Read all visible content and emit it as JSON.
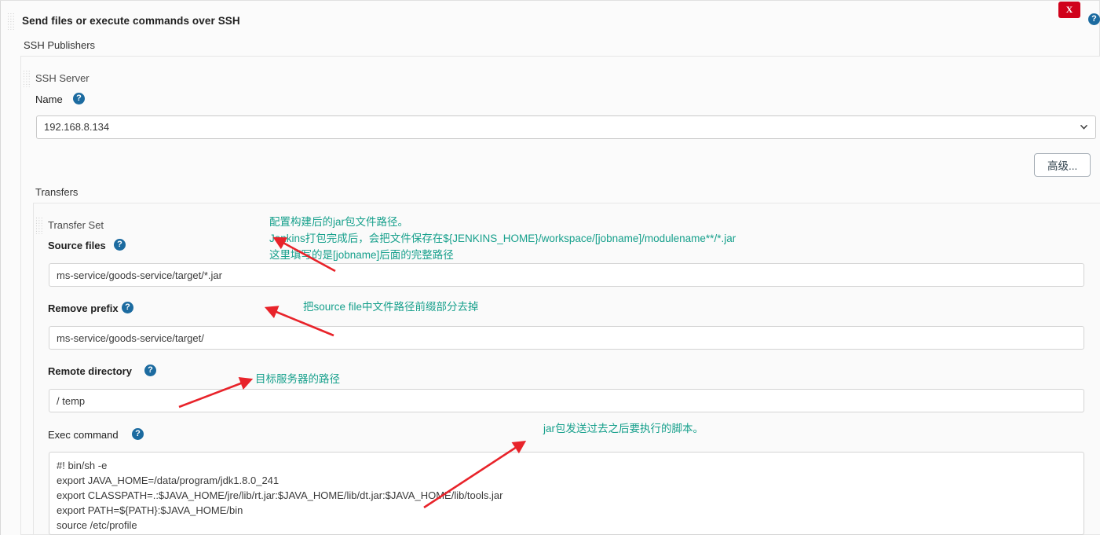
{
  "window": {
    "title": "Send files or execute commands over SSH",
    "close_label": "X",
    "help_icon": "help-circle-icon"
  },
  "publishers": {
    "section_label": "SSH Publishers",
    "server": {
      "group_label": "SSH Server",
      "name_label": "Name",
      "name_value": "192.168.8.134",
      "name_options": [
        "192.168.8.134"
      ],
      "advanced_button": "高级..."
    },
    "transfers": {
      "section_label": "Transfers",
      "transfer_set_label": "Transfer Set",
      "fields": {
        "source_files": {
          "label": "Source files",
          "value": "ms-service/goods-service/target/*.jar"
        },
        "remove_prefix": {
          "label": "Remove prefix",
          "value": "ms-service/goods-service/target/"
        },
        "remote_directory": {
          "label": "Remote directory",
          "value": "/ temp"
        },
        "exec_command": {
          "label": "Exec command",
          "value": "#! bin/sh -e\nexport JAVA_HOME=/data/program/jdk1.8.0_241\nexport CLASSPATH=.:$JAVA_HOME/jre/lib/rt.jar:$JAVA_HOME/lib/dt.jar:$JAVA_HOME/lib/tools.jar\nexport PATH=${PATH}:$JAVA_HOME/bin\nsource /etc/profile"
        }
      }
    }
  },
  "annotations": {
    "source_files": "配置构建后的jar包文件路径。\nJenkins打包完成后，会把文件保存在${JENKINS_HOME}/workspace/[jobname]/modulename**/*.jar\n这里填写的是[jobname]后面的完整路径",
    "remove_prefix": "把source file中文件路径前缀部分去掉",
    "remote_directory": "目标服务器的路径",
    "exec_command": "jar包发送过去之后要执行的脚本。"
  },
  "colors": {
    "annotation": "#17a08c",
    "arrow": "#e8232a",
    "close_button": "#d0021b",
    "help_icon": "#1c6ba0"
  }
}
